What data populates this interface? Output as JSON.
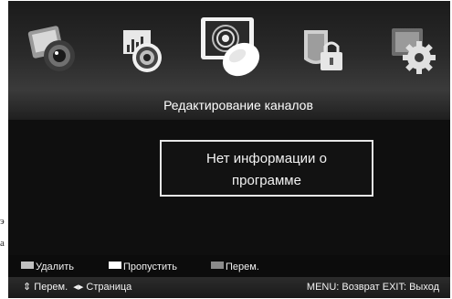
{
  "menu_icons": [
    {
      "name": "picture-icon",
      "selected": false
    },
    {
      "name": "sound-icon",
      "selected": false
    },
    {
      "name": "channel-icon",
      "selected": true
    },
    {
      "name": "lock-icon",
      "selected": false
    },
    {
      "name": "settings-icon",
      "selected": false
    }
  ],
  "header": {
    "title": "Редактирование каналов"
  },
  "message": {
    "line1": "Нет информации о",
    "line2": "программе"
  },
  "legend": {
    "delete_label": "Удалить",
    "skip_label": "Пропустить",
    "move_label": "Перем.",
    "delete_color": "#c0c0c0",
    "skip_color": "#ffffff",
    "move_color": "#8a8a8a"
  },
  "help": {
    "updown_glyph": "⇕",
    "updown_label": "Перем.",
    "leftright_glyph": "◂▸",
    "leftright_label": "Страница",
    "menu_label": "MENU: Возврат",
    "exit_label": "EXIT: Выход"
  },
  "edge_text": {
    "upper": "э",
    "lower": "а"
  }
}
